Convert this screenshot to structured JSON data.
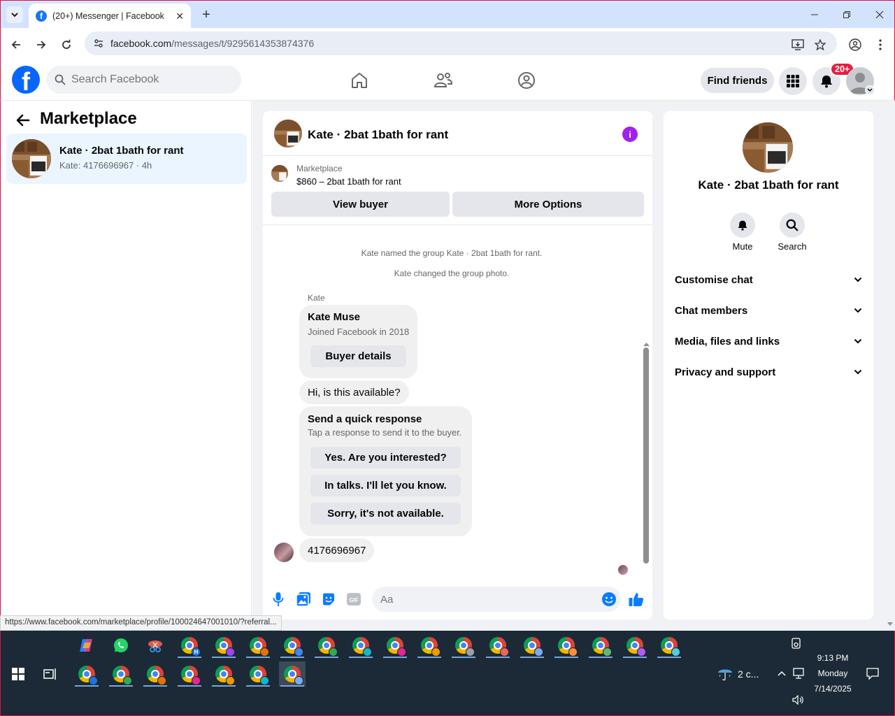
{
  "browser": {
    "tab_title": "(20+) Messenger | Facebook",
    "url_host": "facebook.com",
    "url_path": "/messages/t/9295614353874376",
    "status_url": "https://www.facebook.com/marketplace/profile/100024647001010/?referral..."
  },
  "fb_header": {
    "search_placeholder": "Search Facebook",
    "find_friends": "Find friends",
    "notif_badge": "20+",
    "logo_glyph": "f"
  },
  "left": {
    "title": "Marketplace",
    "conversation": {
      "name": "Kate · 2bat 1bath for rant",
      "subtitle": "Kate: 4176696967 · 4h"
    }
  },
  "chat": {
    "title": "Kate · 2bat 1bath for rant",
    "listing_kicker": "Marketplace",
    "listing_title": "$860 – 2bat 1bath for rant",
    "view_buyer": "View buyer",
    "more_options": "More Options",
    "system_msgs": [
      "Kate named the group Kate · 2bat 1bath for rant.",
      "Kate changed the group photo."
    ],
    "sender": "Kate",
    "card": {
      "name": "Kate Muse",
      "joined": "Joined Facebook in 2018",
      "button": "Buyer details"
    },
    "msg_hi": "Hi, is this available?",
    "quick": {
      "title": "Send a quick response",
      "subtitle": "Tap a response to send it to the buyer.",
      "options": [
        "Yes. Are you interested?",
        "In talks. I'll let you know.",
        "Sorry, it's not available."
      ]
    },
    "msg_number": "4176696967",
    "input_placeholder": "Aa"
  },
  "right": {
    "name": "Kate · 2bat 1bath for rant",
    "mute": "Mute",
    "search": "Search",
    "sections": [
      "Customise chat",
      "Chat members",
      "Media, files and links",
      "Privacy and support"
    ]
  },
  "taskbar": {
    "weather": "2 c...",
    "time": "9:13 PM",
    "day": "Monday",
    "date": "7/14/2025"
  },
  "colors": {
    "fb_blue": "#0866ff",
    "messenger_accent": "#0a7cff",
    "info_purple": "#a020f0",
    "badge_red": "#e41e3f"
  }
}
